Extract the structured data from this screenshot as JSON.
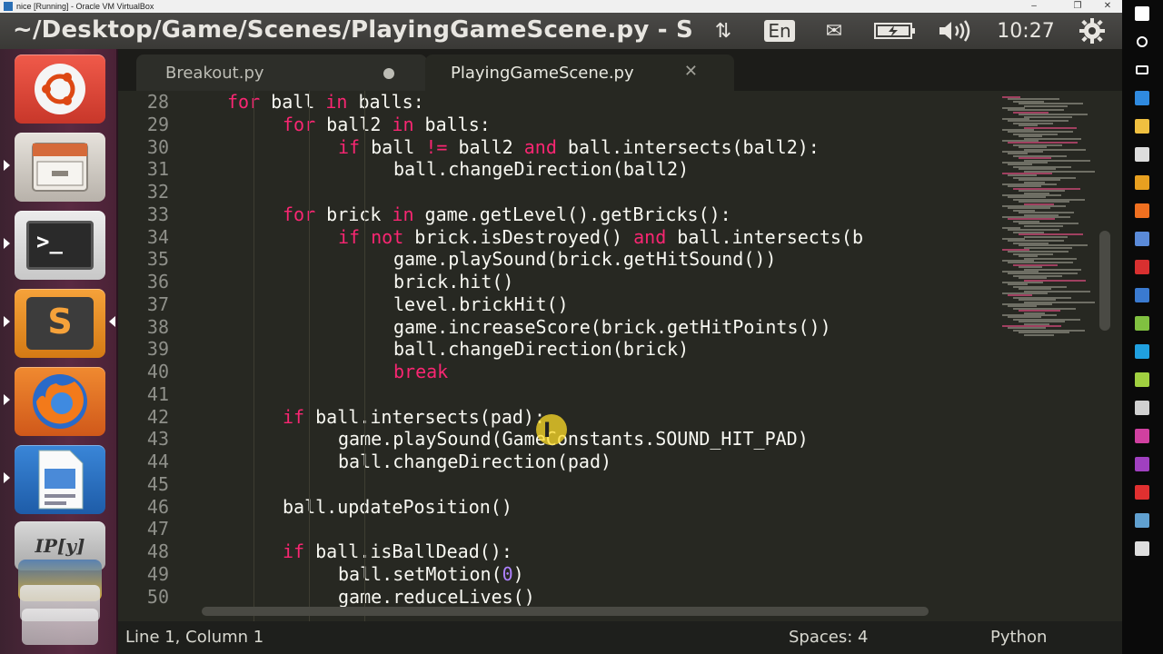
{
  "host": {
    "vbox_title": "nice [Running] - Oracle VM VirtualBox",
    "vbox_controls": [
      "–",
      "❐",
      "✕"
    ]
  },
  "top_panel": {
    "window_title": "~/Desktop/Game/Scenes/PlayingGameScene.py - Subl",
    "keyboard": "En",
    "clock": "10:27"
  },
  "launcher": {
    "items": [
      {
        "name": "dash-home",
        "icon": "ubuntu-logo-icon"
      },
      {
        "name": "files",
        "icon": "file-cabinet-icon"
      },
      {
        "name": "terminal",
        "icon": "terminal-icon",
        "glyph": ">_"
      },
      {
        "name": "sublime-text",
        "icon": "sublime-text-icon",
        "glyph": "S"
      },
      {
        "name": "firefox",
        "icon": "firefox-icon"
      },
      {
        "name": "libreoffice-impress",
        "icon": "presentation-icon"
      },
      {
        "name": "ipython",
        "icon": "ipython-icon",
        "glyph": "IP[y]"
      }
    ]
  },
  "tabs": [
    {
      "label": "Breakout.py",
      "state": "modified"
    },
    {
      "label": "PlayingGameScene.py",
      "state": "active"
    }
  ],
  "code": {
    "lines": [
      {
        "n": "28",
        "indent": 0,
        "parts": [
          [
            "kw",
            "for"
          ],
          [
            "t",
            " ball "
          ],
          [
            "kw",
            "in"
          ],
          [
            "t",
            " balls:"
          ]
        ]
      },
      {
        "n": "29",
        "indent": 1,
        "parts": [
          [
            "kw",
            "for"
          ],
          [
            "t",
            " ball2 "
          ],
          [
            "kw",
            "in"
          ],
          [
            "t",
            " balls:"
          ]
        ]
      },
      {
        "n": "30",
        "indent": 2,
        "parts": [
          [
            "kw",
            "if"
          ],
          [
            "t",
            " ball "
          ],
          [
            "kw",
            "!="
          ],
          [
            "t",
            " ball2 "
          ],
          [
            "kw",
            "and"
          ],
          [
            "t",
            " ball.intersects(ball2):"
          ]
        ]
      },
      {
        "n": "31",
        "indent": 3,
        "parts": [
          [
            "t",
            "ball.changeDirection(ball2)"
          ]
        ]
      },
      {
        "n": "32",
        "indent": 0,
        "parts": []
      },
      {
        "n": "33",
        "indent": 1,
        "parts": [
          [
            "kw",
            "for"
          ],
          [
            "t",
            " brick "
          ],
          [
            "kw",
            "in"
          ],
          [
            "t",
            " game.getLevel().getBricks():"
          ]
        ]
      },
      {
        "n": "34",
        "indent": 2,
        "parts": [
          [
            "kw",
            "if"
          ],
          [
            "t",
            " "
          ],
          [
            "kw",
            "not"
          ],
          [
            "t",
            " brick.isDestroyed() "
          ],
          [
            "kw",
            "and"
          ],
          [
            "t",
            " ball.intersects(b"
          ]
        ]
      },
      {
        "n": "35",
        "indent": 3,
        "parts": [
          [
            "t",
            "game.playSound(brick.getHitSound())"
          ]
        ]
      },
      {
        "n": "36",
        "indent": 3,
        "parts": [
          [
            "t",
            "brick.hit()"
          ]
        ]
      },
      {
        "n": "37",
        "indent": 3,
        "parts": [
          [
            "t",
            "level.brickHit()"
          ]
        ]
      },
      {
        "n": "38",
        "indent": 3,
        "parts": [
          [
            "t",
            "game.increaseScore(brick.getHitPoints())"
          ]
        ]
      },
      {
        "n": "39",
        "indent": 3,
        "parts": [
          [
            "t",
            "ball.changeDirection(brick)"
          ]
        ]
      },
      {
        "n": "40",
        "indent": 3,
        "parts": [
          [
            "kw",
            "break"
          ]
        ]
      },
      {
        "n": "41",
        "indent": 0,
        "parts": []
      },
      {
        "n": "42",
        "indent": 1,
        "parts": [
          [
            "kw",
            "if"
          ],
          [
            "t",
            " ball.intersects(pad):"
          ]
        ]
      },
      {
        "n": "43",
        "indent": 2,
        "parts": [
          [
            "t",
            "game.playSound(GameConstants.SOUND_HIT_PAD)"
          ]
        ]
      },
      {
        "n": "44",
        "indent": 2,
        "parts": [
          [
            "t",
            "ball.changeDirection(pad)"
          ]
        ]
      },
      {
        "n": "45",
        "indent": 0,
        "parts": []
      },
      {
        "n": "46",
        "indent": 1,
        "parts": [
          [
            "t",
            "ball.updatePosition()"
          ]
        ]
      },
      {
        "n": "47",
        "indent": 0,
        "parts": []
      },
      {
        "n": "48",
        "indent": 1,
        "parts": [
          [
            "kw",
            "if"
          ],
          [
            "t",
            " ball.isBallDead():"
          ]
        ]
      },
      {
        "n": "49",
        "indent": 2,
        "parts": [
          [
            "t",
            "ball.setMotion("
          ],
          [
            "num",
            "0"
          ],
          [
            "t",
            ")"
          ]
        ]
      },
      {
        "n": "50",
        "indent": 2,
        "parts": [
          [
            "t",
            "game.reduceLives()"
          ]
        ]
      }
    ]
  },
  "statusbar": {
    "position": "Line 1, Column 1",
    "spaces": "Spaces: 4",
    "syntax": "Python"
  },
  "colors": {
    "keyword": "#f92672",
    "number": "#ae81ff",
    "text": "#f8f8f2",
    "background": "#272822"
  },
  "win_taskbar": {
    "icons": [
      "windows-logo-icon",
      "cortana-circle-icon",
      "task-view-icon",
      "edge-icon",
      "file-explorer-icon",
      "store-icon",
      "chrome-icon",
      "firefox-icon",
      "virtualbox-icon",
      "app-red-icon",
      "app-blue-icon",
      "app-green-icon",
      "skype-icon",
      "notepad-icon",
      "app-bird-icon",
      "app-pink-icon",
      "app-purple-icon",
      "pdf-icon",
      "app-screen-icon",
      "photos-icon"
    ]
  }
}
